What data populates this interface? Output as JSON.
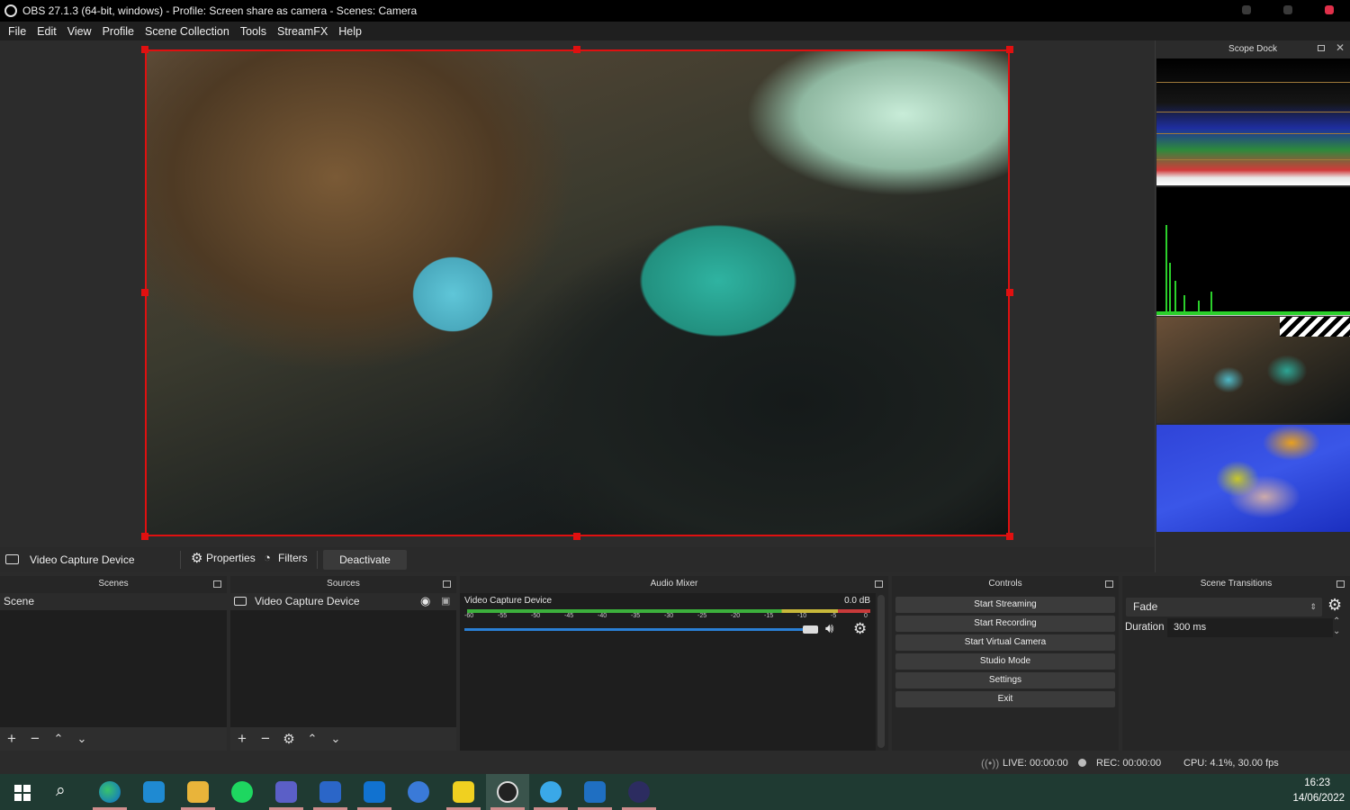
{
  "window": {
    "title": "OBS 27.1.3 (64-bit, windows) - Profile: Screen share as camera - Scenes: Camera"
  },
  "menu": [
    "File",
    "Edit",
    "View",
    "Profile",
    "Scene Collection",
    "Tools",
    "StreamFX",
    "Help"
  ],
  "scope_dock": {
    "title": "Scope Dock"
  },
  "source_toolbar": {
    "source_name": "Video Capture Device",
    "properties": "Properties",
    "filters": "Filters",
    "deactivate": "Deactivate"
  },
  "scenes": {
    "title": "Scenes",
    "items": [
      "Scene"
    ]
  },
  "sources": {
    "title": "Sources",
    "items": [
      "Video Capture Device"
    ]
  },
  "audio_mixer": {
    "title": "Audio Mixer",
    "channel": "Video Capture Device",
    "db": "0.0 dB",
    "scale": [
      "-60",
      "-55",
      "-50",
      "-45",
      "-40",
      "-35",
      "-30",
      "-25",
      "-20",
      "-15",
      "-10",
      "-5",
      "0"
    ],
    "volume_level": 0.99
  },
  "controls": {
    "title": "Controls",
    "buttons": [
      "Start Streaming",
      "Start Recording",
      "Start Virtual Camera",
      "Studio Mode",
      "Settings",
      "Exit"
    ]
  },
  "transitions": {
    "title": "Scene Transitions",
    "selected": "Fade",
    "duration_label": "Duration",
    "duration_value": "300 ms"
  },
  "status": {
    "live": "LIVE: 00:00:00",
    "rec": "REC: 00:00:00",
    "cpu": "CPU: 4.1%, 30.00 fps"
  },
  "clock": {
    "time": "16:23",
    "date": "14/06/2022"
  },
  "colors": {
    "selection": "#e01010",
    "accent_blue": "#2a7fd4",
    "meter_green": "#3cb03c"
  }
}
